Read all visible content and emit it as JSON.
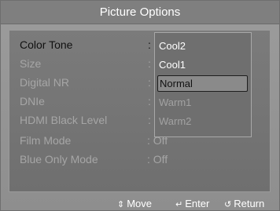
{
  "title": "Picture Options",
  "menu": {
    "items": [
      {
        "label": "Color Tone",
        "value": ":",
        "active": true
      },
      {
        "label": "Size",
        "value": ":",
        "active": false
      },
      {
        "label": "Digital NR",
        "value": ":",
        "active": false
      },
      {
        "label": "DNIe",
        "value": ":",
        "active": false
      },
      {
        "label": "HDMI Black Level",
        "value": ":",
        "active": false
      },
      {
        "label": "Film Mode",
        "value": ": Off",
        "active": false
      },
      {
        "label": "Blue Only Mode",
        "value": ": Off",
        "active": false
      }
    ]
  },
  "dropdown": {
    "options": [
      {
        "label": "Cool2",
        "enabled": true
      },
      {
        "label": "Cool1",
        "enabled": true
      },
      {
        "label": "Normal",
        "enabled": true,
        "selected": true
      },
      {
        "label": "Warm1",
        "enabled": false
      },
      {
        "label": "Warm2",
        "enabled": false
      }
    ]
  },
  "footer": {
    "move": {
      "icon": "up-down-arrows-icon",
      "label": "Move"
    },
    "enter": {
      "icon": "enter-icon",
      "label": "Enter"
    },
    "return": {
      "icon": "return-icon",
      "label": "Return"
    }
  }
}
